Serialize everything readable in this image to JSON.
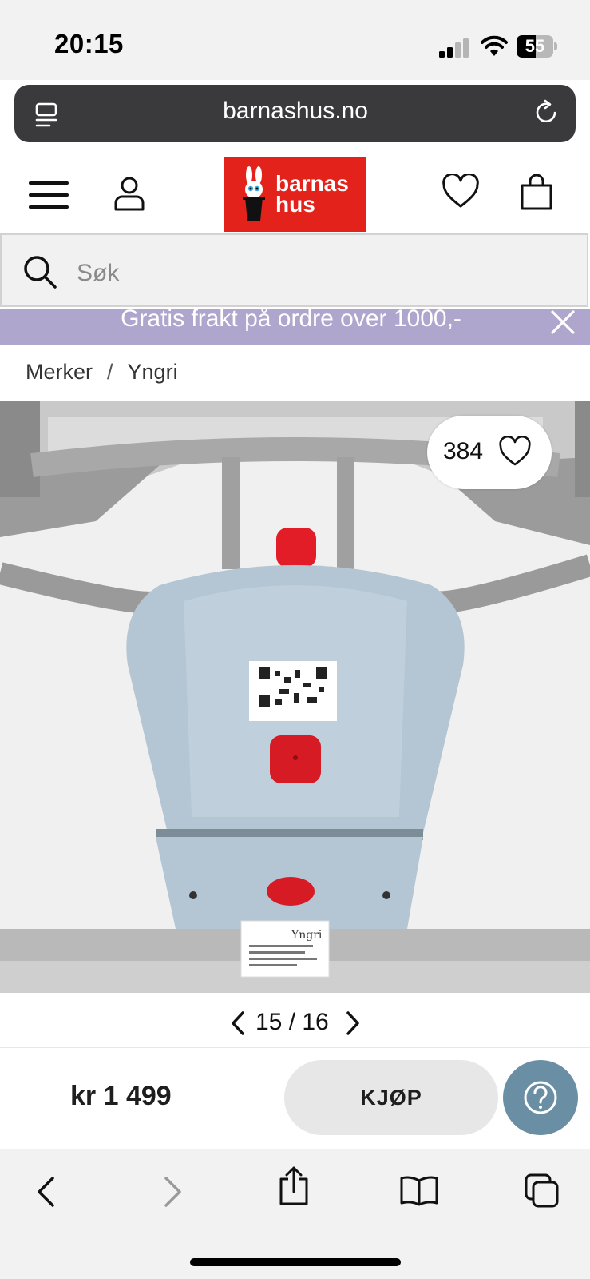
{
  "status_bar": {
    "time": "20:15",
    "battery": "55"
  },
  "browser": {
    "url": "barnashus.no"
  },
  "header": {
    "logo_line1": "barnas",
    "logo_line2": "hus"
  },
  "search": {
    "placeholder": "Søk"
  },
  "banner": {
    "text": "Gratis frakt på ordre over 1000,-"
  },
  "breadcrumb": {
    "items": [
      "Merker",
      "Yngri"
    ],
    "separator": "/"
  },
  "product": {
    "likes": "384",
    "pager": "15 / 16",
    "price": "kr 1 499",
    "buy_label": "KJØP",
    "label_brand": "Yngri"
  },
  "colors": {
    "brand_red": "#e3231b",
    "banner_purple": "#aea6cc",
    "help_blue": "#6a8ea4"
  },
  "icons": [
    "signal-icon",
    "wifi-icon",
    "battery-icon",
    "tabs-overview-icon",
    "reload-icon",
    "menu-icon",
    "user-icon",
    "heart-icon",
    "bag-icon",
    "search-icon",
    "close-icon",
    "chevron-left-icon",
    "chevron-right-icon",
    "help-icon",
    "back-icon",
    "forward-icon",
    "share-icon",
    "bookmarks-icon",
    "tabs-icon"
  ]
}
